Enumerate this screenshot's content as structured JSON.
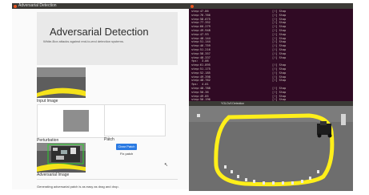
{
  "app": {
    "window_title": "Adversarial Detection",
    "heading": "Adversarial Detection",
    "subtitle": "White-Box attacks against end-to-end detection systems.",
    "input_label": "Input Image",
    "perturbation_label": "Perturbation",
    "patch_label": "Patch",
    "adversarial_label": "Adversarial Image",
    "clear_button": "Clear Patch",
    "fix_patch_label": "Fix patch",
    "status_text": "Generating adversarial patch is as easy as drag and drop."
  },
  "terminal": {
    "left_lines": [
      "step:47.86",
      "step:76.766",
      "step:58.675",
      "step:77.352",
      "step:60.279",
      "step:49.948",
      "step:47.93",
      "step:48.144",
      "step:51.144",
      "step:46.759",
      "step:51.216",
      "step:58.357",
      "step:48.337",
      "fps:  3.06",
      "step:61.895",
      "step:51.175",
      "step:52.185",
      "step:49.398",
      "step:48.762",
      "fps:  4.01",
      "step:48.788",
      "step:50.36",
      "step:49.85",
      "step:50.196",
      "step:49.565",
      "step:57.208",
      "fps:  4.01"
    ],
    "right_lines": [
      "Stop",
      "Stop",
      "Stop",
      "Stop",
      "Stop",
      "Stop",
      "Stop",
      "Stop",
      "Stop",
      "Stop",
      "Stop",
      "Stop",
      "Stop",
      "",
      "Stop",
      "Stop",
      "Stop",
      "Stop",
      "Stop",
      "",
      "Stop",
      "Stop",
      "Stop",
      "Stop",
      "Stop",
      "Stop",
      ""
    ]
  },
  "camera": {
    "window_title": "YOLOv3 Detection"
  },
  "colors": {
    "terminal_bg": "#300a24",
    "tape_yellow": "#ffef1a",
    "button_blue": "#2a7ae2"
  }
}
